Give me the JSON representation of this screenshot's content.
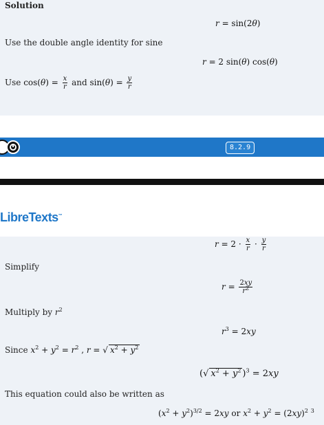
{
  "solution": {
    "heading": "Solution",
    "steps": [
      {
        "text": "",
        "math": "r = sin(2θ)"
      },
      {
        "text": "Use the double angle identity for sine",
        "math": "r = 2 sin(θ) cos(θ)"
      },
      {
        "text_prefix": "Use ",
        "text_and": "and",
        "math": ""
      }
    ]
  },
  "toolbar": {
    "version": "8.2.9",
    "logo": "LibreTexts",
    "logo_tm": "™"
  },
  "continued": {
    "steps": [
      {
        "text": "",
        "math": "r = 2 · x/r · y/r"
      },
      {
        "text": "Simplify",
        "math": "r = 2xy / r²"
      },
      {
        "text": "Multiply by r²",
        "math": "r³ = 2xy"
      },
      {
        "text": "Since",
        "math": "(√(x²+y²))³ = 2xy"
      },
      {
        "text": "This equation could also be written as",
        "math": "(x²+y²)^(3/2) = 2xy or x²+y² = (2xy)^(2/3)"
      }
    ],
    "or_word": "or"
  }
}
